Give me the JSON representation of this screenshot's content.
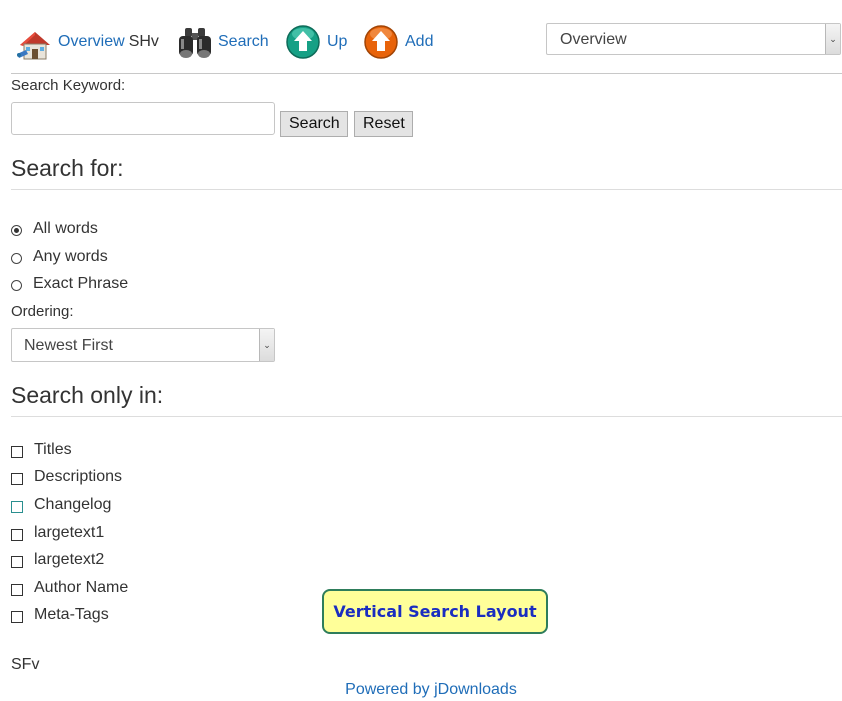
{
  "nav": {
    "overview_label": "Overview",
    "overview_suffix": "SHv",
    "search_label": "Search",
    "up_label": "Up",
    "add_label": "Add",
    "select_value": "Overview"
  },
  "form": {
    "keyword_label": "Search Keyword:",
    "keyword_value": "",
    "search_button": "Search",
    "reset_button": "Reset",
    "search_for_heading": "Search for:",
    "match_options": [
      {
        "label": "All words",
        "checked": true
      },
      {
        "label": "Any words",
        "checked": false
      },
      {
        "label": "Exact Phrase",
        "checked": false
      }
    ],
    "ordering_label": "Ordering:",
    "ordering_value": "Newest First",
    "search_only_heading": "Search only in:",
    "fields": [
      {
        "label": "Titles",
        "checked": false
      },
      {
        "label": "Descriptions",
        "checked": false
      },
      {
        "label": "Changelog",
        "checked": false
      },
      {
        "label": "largetext1",
        "checked": false
      },
      {
        "label": "largetext2",
        "checked": false
      },
      {
        "label": "Author Name",
        "checked": false
      },
      {
        "label": "Meta-Tags",
        "checked": false
      }
    ]
  },
  "badge": "Vertical Search Layout",
  "footer": {
    "sfv": "SFv",
    "powered": "Powered by jDownloads"
  },
  "colors": {
    "link": "#1f6db8",
    "badge_bg": "#ffff99",
    "badge_border": "#2e7d5b",
    "badge_text": "#1a2dc0"
  },
  "icons": {
    "overview": "house-icon",
    "search": "binoculars-icon",
    "up": "up-arrow-icon",
    "add": "add-arrow-icon"
  }
}
